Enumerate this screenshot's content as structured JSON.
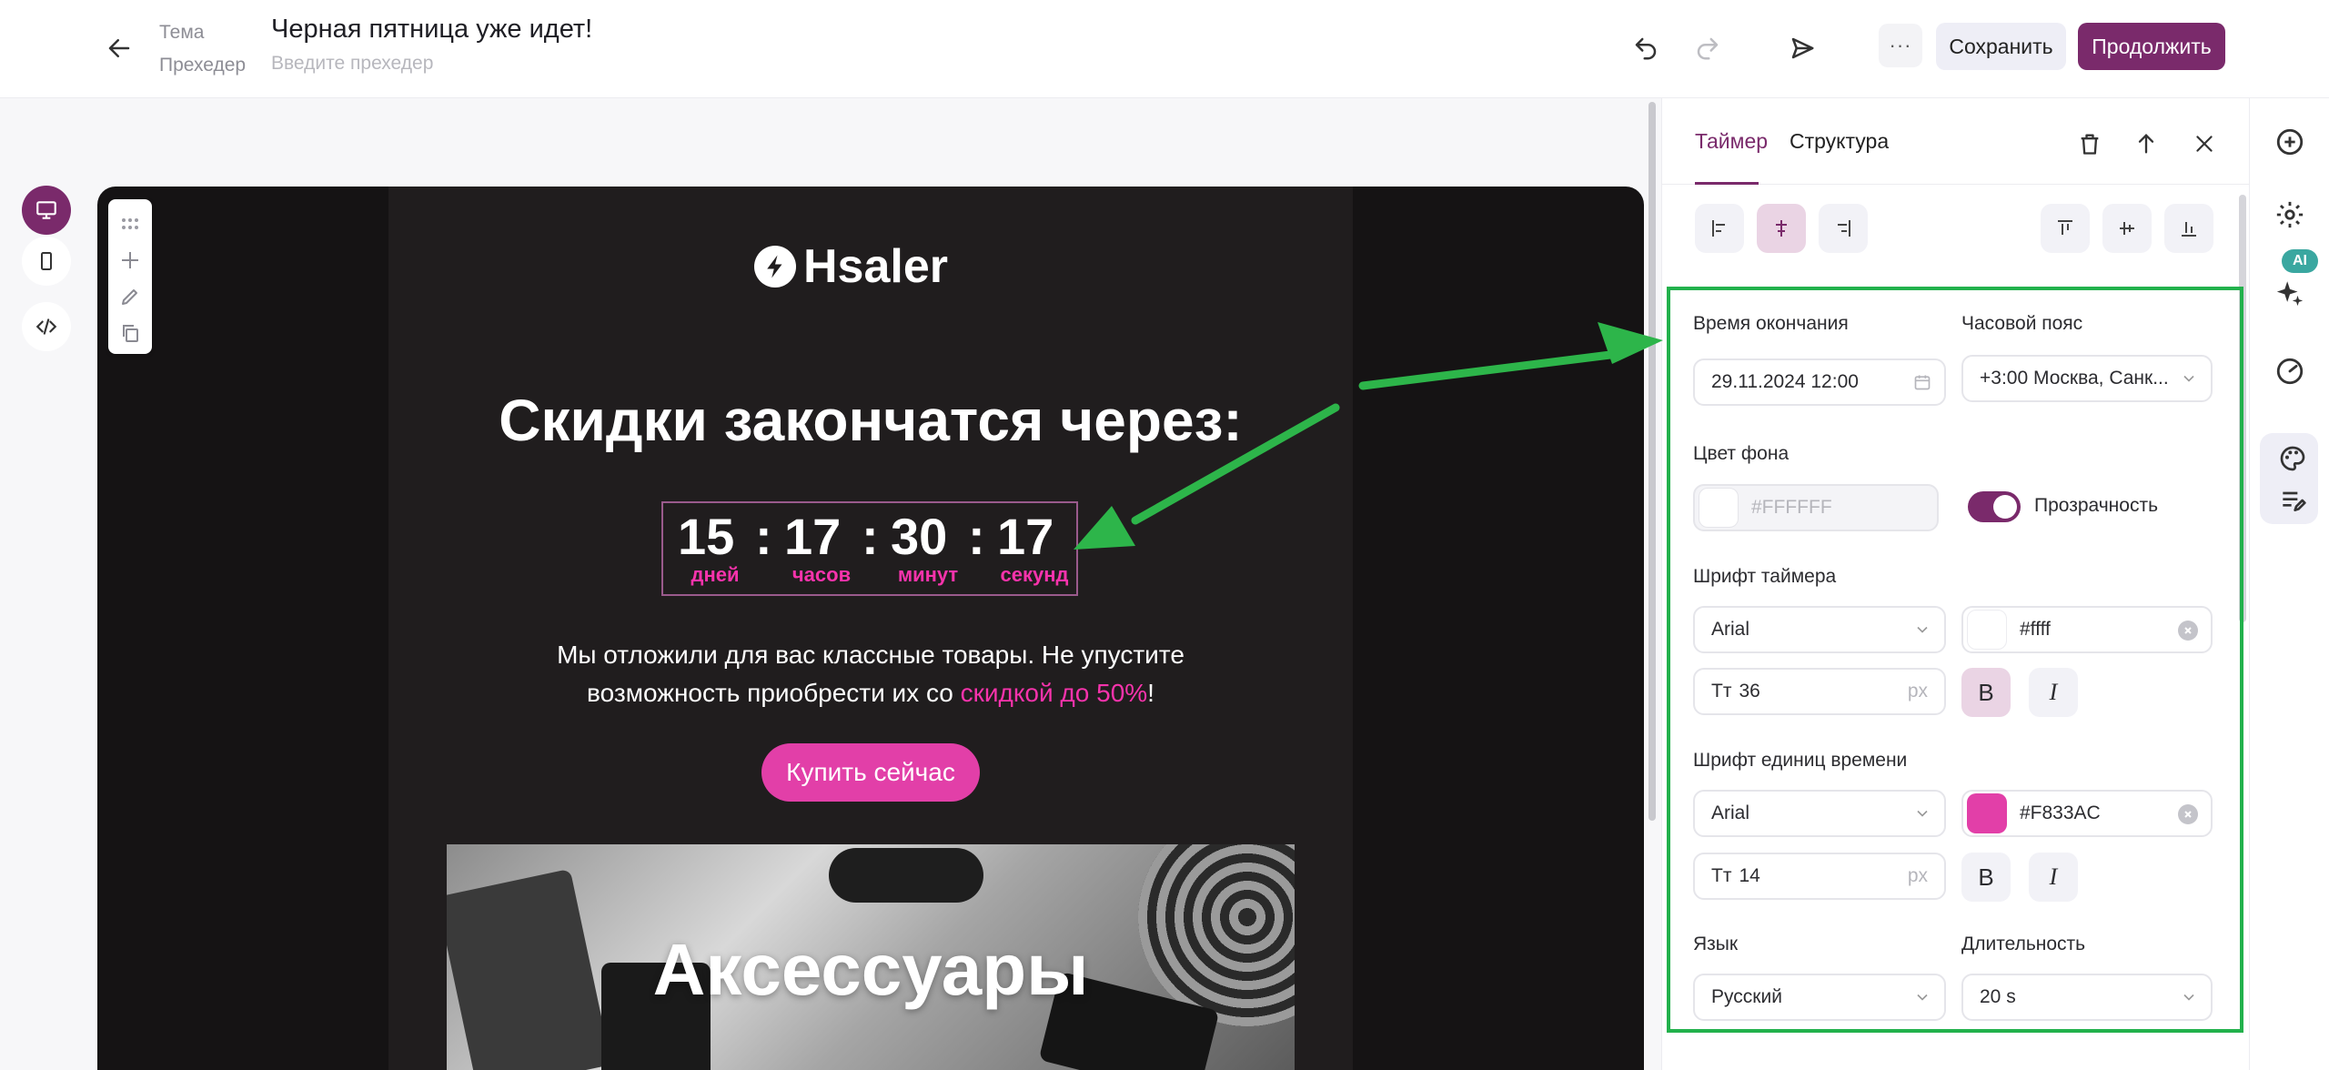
{
  "header": {
    "subject_label": "Тема",
    "preheader_label": "Прехедер",
    "subject_value": "Черная пятница уже идет!",
    "preheader_placeholder": "Введите прехедер",
    "more_label": "···",
    "save_label": "Сохранить",
    "continue_label": "Продолжить",
    "icons": [
      "arrow-left-icon",
      "undo-icon",
      "redo-icon",
      "send-icon"
    ]
  },
  "left_rail": {
    "items": [
      "desktop-icon",
      "mobile-icon",
      "code-icon"
    ]
  },
  "email": {
    "logo_text": "Hsaler",
    "headline": "Скидки закончатся через:",
    "timer": {
      "values": [
        "15",
        "17",
        "30",
        "17"
      ],
      "separator": ":",
      "units": [
        "дней",
        "часов",
        "минут",
        "секунд"
      ]
    },
    "body_line1": "Мы отложили для вас классные товары. Не упустите",
    "body_line2_prefix": "возможность приобрести их со ",
    "body_line2_accent": "скидкой до 50%",
    "body_line2_suffix": "!",
    "cta_label": "Купить сейчас",
    "banner_title": "Аксессуары"
  },
  "panel": {
    "tabs": [
      "Таймер",
      "Структура"
    ],
    "active_tab": "Таймер",
    "end_time_label": "Время окончания",
    "end_time_value": "29.11.2024 12:00",
    "timezone_label": "Часовой пояс",
    "timezone_value": "+3:00 Москва, Санк...",
    "bg_color_label": "Цвет фона",
    "bg_color_placeholder": "#FFFFFF",
    "transparency_label": "Прозрачность",
    "transparency_on": true,
    "timer_font_label": "Шрифт таймера",
    "timer_font_family": "Arial",
    "timer_font_color": "#ffff",
    "timer_font_size": "36",
    "timer_bold_active": true,
    "units_font_label": "Шрифт единиц времени",
    "units_font_family": "Arial",
    "units_font_color": "#F833AC",
    "units_font_size": "14",
    "size_prefix": "Tт",
    "size_suffix": "px",
    "bold_label": "B",
    "italic_label": "I",
    "language_label": "Язык",
    "language_value": "Русский",
    "duration_label": "Длительность",
    "duration_value": "20 s"
  },
  "right_rail": {
    "ai_badge": "AI",
    "items": [
      "plus-circle-icon",
      "gear-icon",
      "sparkles-icon",
      "gauge-icon",
      "palette-icon",
      "list-edit-icon"
    ]
  },
  "colors": {
    "brand": "#7a2a6b",
    "accent_pink": "#F833AC",
    "highlight_frame": "#22b14c",
    "email_bg": "#201d1e"
  }
}
